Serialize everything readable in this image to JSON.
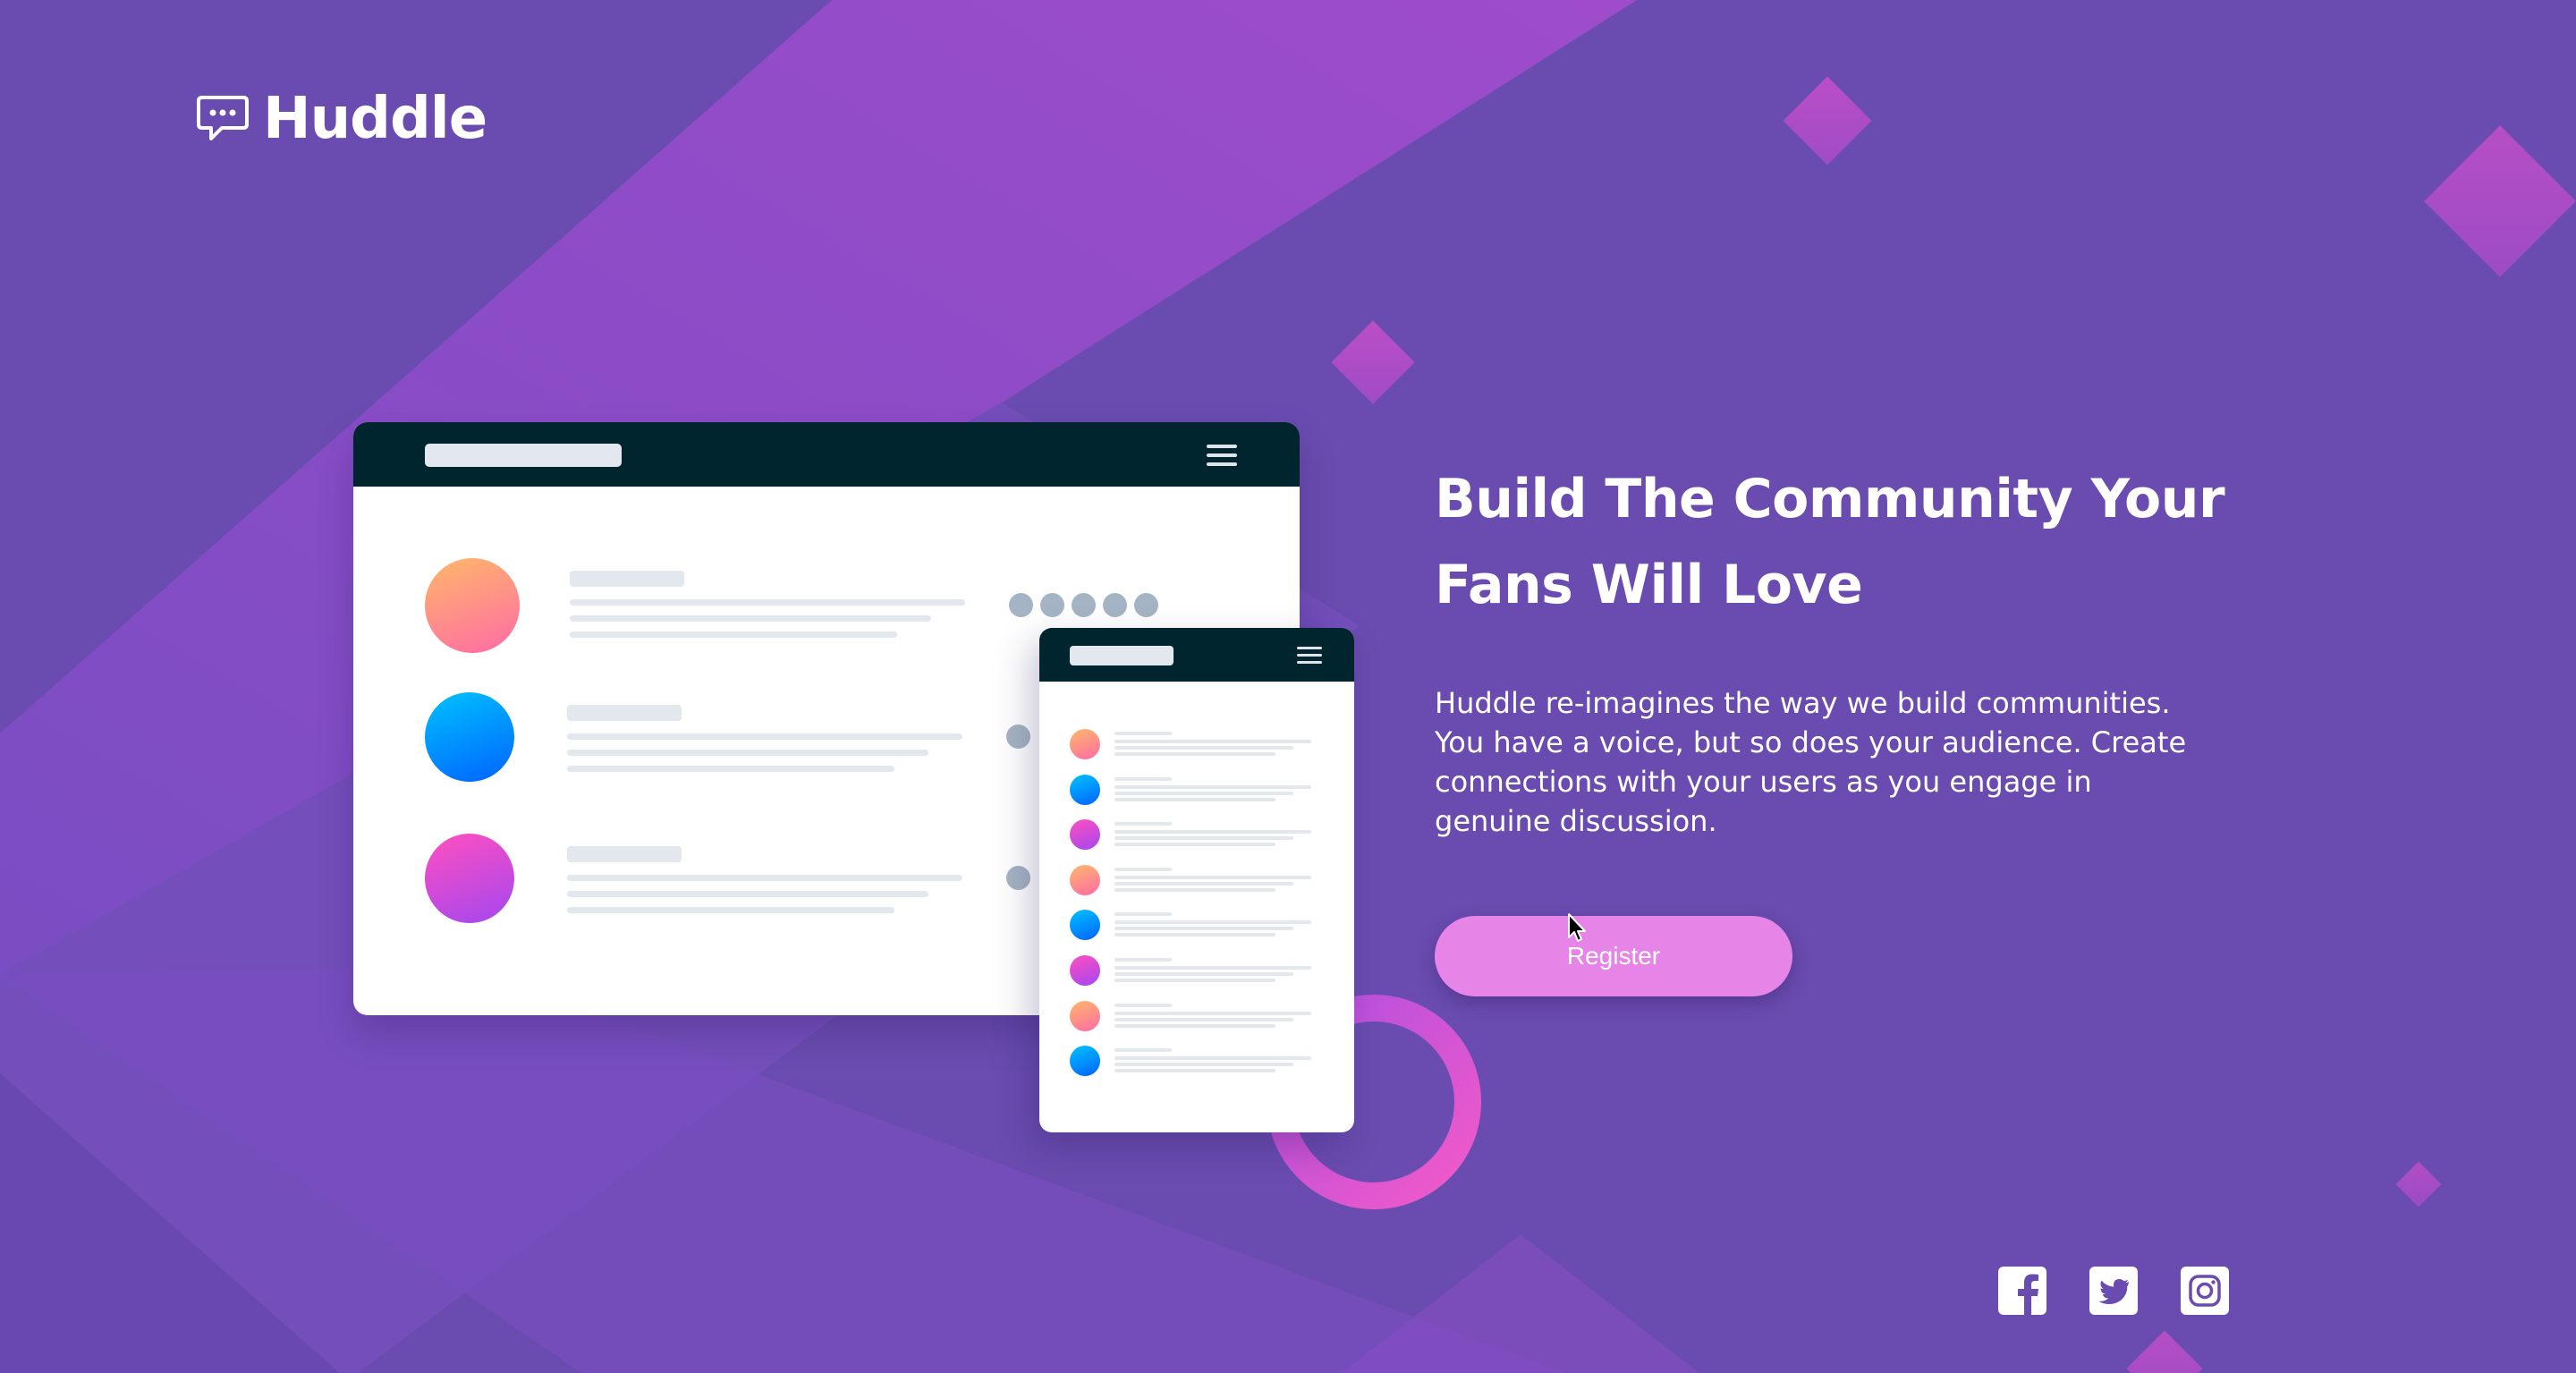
{
  "brand": {
    "name": "Huddle",
    "logo_icon": "chat-bubble-icon"
  },
  "hero": {
    "title": "Build The Community Your Fans Will Love",
    "description": "Huddle re-imagines the way we build communities. You have a voice, but so does your audience. Create connections with your users as you engage in genuine discussion.",
    "register_label": "Register"
  },
  "social": [
    {
      "name": "Facebook",
      "icon": "facebook-icon"
    },
    {
      "name": "Twitter",
      "icon": "twitter-icon"
    },
    {
      "name": "Instagram",
      "icon": "instagram-icon"
    }
  ],
  "colors": {
    "background": "#6a4cb0",
    "accent_pink": "#e684e8",
    "mockup_header": "#00252e"
  }
}
